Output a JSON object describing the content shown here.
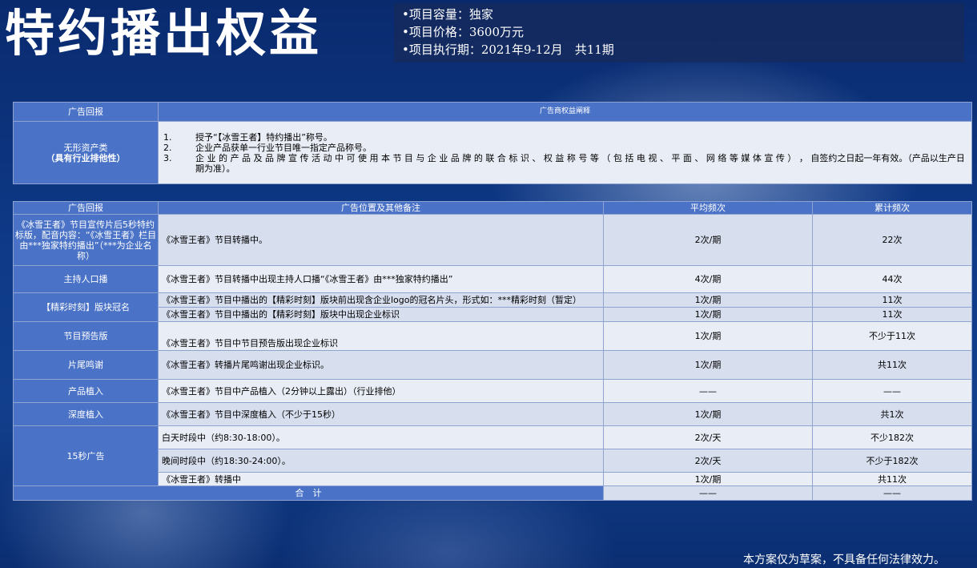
{
  "title": "特约播出权益",
  "info": {
    "capacity": "•项目容量：独家",
    "price": "•项目价格：3600万元",
    "period": "•项目执行期：2021年9-12月　共11期"
  },
  "table1": {
    "headers": [
      "广告回报",
      "广告商权益阐释"
    ],
    "category_line1": "无形资产类",
    "category_line2": "（具有行业排他性）",
    "items": [
      {
        "n": "1.",
        "text": "授予“【冰雪王者】特约播出”称号。"
      },
      {
        "n": "2.",
        "text": "企业产品获单一行业节目唯一指定产品称号。"
      },
      {
        "n": "3.",
        "text": "企 业 的 产 品 及 品 牌 宣 传 活 动 中 可 使 用 本 节 目 与 企 业 品 牌 的 联 合 标 识 、 权 益 称 号 等 （ 包 括 电 视 、 平 面 、 网 络 等 媒 体 宣 传 ） ， 自签约之日起一年有效。（产品以生产日期为准）。"
      }
    ]
  },
  "table2": {
    "headers": [
      "广告回报",
      "广告位置及其他备注",
      "平均频次",
      "累计频次"
    ],
    "rows": [
      {
        "cat": "《冰雪王者》节目宣传片后5秒特约标版，配音内容：“《冰雪王者》栏目由***独家特约播出”（***为企业名称）",
        "desc": "《冰雪王者》节目转播中。",
        "avg": "2次/期",
        "total": "22次"
      },
      {
        "cat": "主持人口播",
        "desc": "《冰雪王者》节目转播中出现主持人口播“《冰雪王者》由***独家特约播出”",
        "avg": "4次/期",
        "total": "44次"
      },
      {
        "cat": "【精彩时刻】版块冠名",
        "desc": "《冰雪王者》节目中播出的【精彩时刻】版块前出现含企业logo的冠名片头，形式如：***精彩时刻（暂定）",
        "avg": "1次/期",
        "total": "11次"
      },
      {
        "desc": "《冰雪王者》节目中播出的【精彩时刻】版块中出现企业标识",
        "avg": "1次/期",
        "total": "11次"
      },
      {
        "cat": "节目预告版",
        "desc": "《冰雪王者》节目中节目预告版出现企业标识",
        "avg": "1次/期",
        "total": "不少于11次"
      },
      {
        "cat": "片尾鸣谢",
        "desc": "《冰雪王者》转播片尾鸣谢出现企业标识。",
        "avg": "1次/期",
        "total": "共11次"
      },
      {
        "cat": "产品植入",
        "desc": "《冰雪王者》节目中产品植入（2分钟以上露出）（行业排他）",
        "avg": "——",
        "total": "——"
      },
      {
        "cat": "深度植入",
        "desc": "《冰雪王者》节目中深度植入（不少于15秒）",
        "avg": "1次/期",
        "total": "共1次"
      },
      {
        "cat": "15秒广告",
        "desc": "白天时段中（约8:30-18:00）。",
        "avg": "2次/天",
        "total": "不少182次"
      },
      {
        "desc": "晚间时段中（约18:30-24:00）。",
        "avg": "2次/天",
        "total": "不少于182次"
      },
      {
        "desc": "《冰雪王者》转播中",
        "avg": "1次/期",
        "total": "共11次"
      }
    ],
    "sum_label": "合　计",
    "sum_avg": "——",
    "sum_total": "——"
  },
  "footer_note": "本方案仅为草案，不具备任何法律效力。"
}
